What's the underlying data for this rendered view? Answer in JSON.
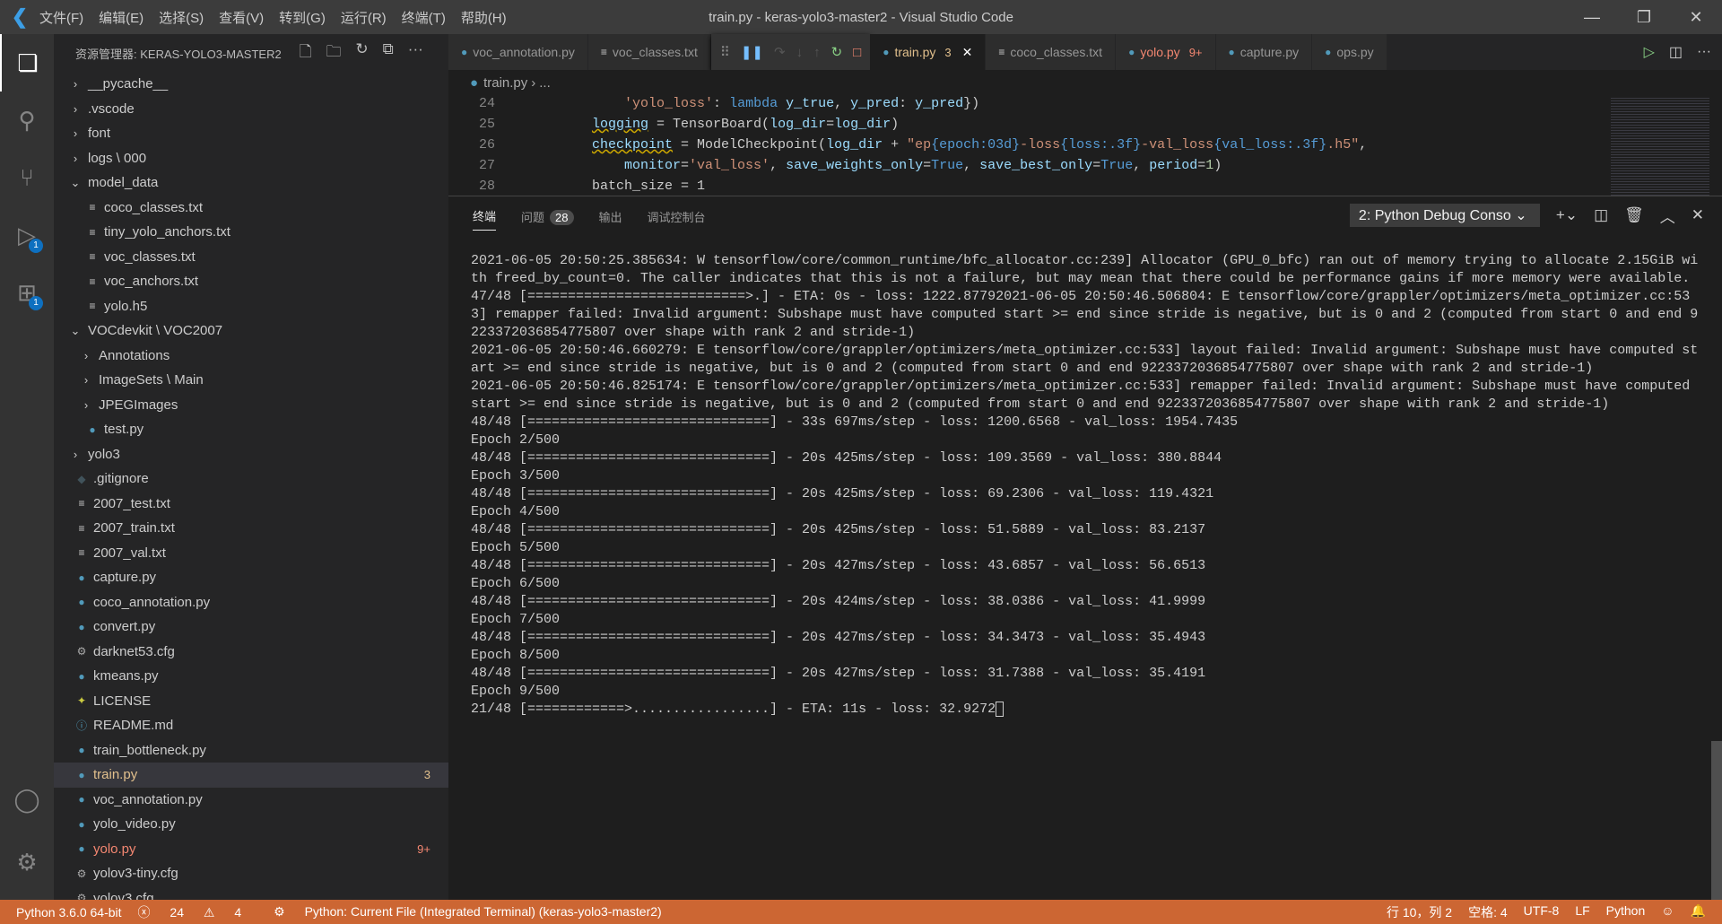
{
  "titlebar": {
    "menu": [
      "文件(F)",
      "编辑(E)",
      "选择(S)",
      "查看(V)",
      "转到(G)",
      "运行(R)",
      "终端(T)",
      "帮助(H)"
    ],
    "title": "train.py - keras-yolo3-master2 - Visual Studio Code"
  },
  "activity": {
    "badges": {
      "debug": "1",
      "extensions": "1"
    }
  },
  "sidebar": {
    "title": "资源管理器: KERAS-YOLO3-MASTER2",
    "items": [
      {
        "label": "__pycache__",
        "type": "folder",
        "indent": 0,
        "open": false
      },
      {
        "label": ".vscode",
        "type": "folder",
        "indent": 0,
        "open": false
      },
      {
        "label": "font",
        "type": "folder",
        "indent": 0,
        "open": false
      },
      {
        "label": "logs \\ 000",
        "type": "folder",
        "indent": 0,
        "open": false
      },
      {
        "label": "model_data",
        "type": "folder",
        "indent": 0,
        "open": true
      },
      {
        "label": "coco_classes.txt",
        "type": "txt",
        "indent": 1
      },
      {
        "label": "tiny_yolo_anchors.txt",
        "type": "txt",
        "indent": 1
      },
      {
        "label": "voc_classes.txt",
        "type": "txt",
        "indent": 1
      },
      {
        "label": "voc_anchors.txt",
        "type": "txt",
        "indent": 1
      },
      {
        "label": "yolo.h5",
        "type": "txt",
        "indent": 1
      },
      {
        "label": "VOCdevkit \\ VOC2007",
        "type": "folder",
        "indent": 0,
        "open": true
      },
      {
        "label": "Annotations",
        "type": "folder",
        "indent": 1,
        "open": false
      },
      {
        "label": "ImageSets \\ Main",
        "type": "folder",
        "indent": 1,
        "open": false
      },
      {
        "label": "JPEGImages",
        "type": "folder",
        "indent": 1,
        "open": false
      },
      {
        "label": "test.py",
        "type": "py",
        "indent": 1
      },
      {
        "label": "yolo3",
        "type": "folder",
        "indent": 0,
        "open": false
      },
      {
        "label": ".gitignore",
        "type": "git",
        "indent": 0
      },
      {
        "label": "2007_test.txt",
        "type": "txt",
        "indent": 0
      },
      {
        "label": "2007_train.txt",
        "type": "txt",
        "indent": 0
      },
      {
        "label": "2007_val.txt",
        "type": "txt",
        "indent": 0
      },
      {
        "label": "capture.py",
        "type": "py",
        "indent": 0
      },
      {
        "label": "coco_annotation.py",
        "type": "py",
        "indent": 0
      },
      {
        "label": "convert.py",
        "type": "py",
        "indent": 0
      },
      {
        "label": "darknet53.cfg",
        "type": "cfg",
        "indent": 0
      },
      {
        "label": "kmeans.py",
        "type": "py",
        "indent": 0
      },
      {
        "label": "LICENSE",
        "type": "license",
        "indent": 0
      },
      {
        "label": "README.md",
        "type": "md",
        "indent": 0
      },
      {
        "label": "train_bottleneck.py",
        "type": "py",
        "indent": 0
      },
      {
        "label": "train.py",
        "type": "py",
        "indent": 0,
        "count": "3",
        "selected": true,
        "color": "#e2c08d"
      },
      {
        "label": "voc_annotation.py",
        "type": "py",
        "indent": 0
      },
      {
        "label": "yolo_video.py",
        "type": "py",
        "indent": 0
      },
      {
        "label": "yolo.py",
        "type": "py",
        "indent": 0,
        "count": "9+",
        "color": "#f48771"
      },
      {
        "label": "yolov3-tiny.cfg",
        "type": "cfg",
        "indent": 0
      },
      {
        "label": "yolov3.cfg",
        "type": "cfg",
        "indent": 0
      }
    ]
  },
  "tabs": [
    {
      "label": "voc_annotation.py",
      "icon": "py"
    },
    {
      "label": "voc_classes.txt",
      "icon": "txt"
    },
    {
      "label": "train.py",
      "icon": "py",
      "count": "3",
      "active": true
    },
    {
      "label": "coco_classes.txt",
      "icon": "txt"
    },
    {
      "label": "yolo.py",
      "icon": "py",
      "count": "9+",
      "color": "#f48771"
    },
    {
      "label": "capture.py",
      "icon": "py"
    },
    {
      "label": "ops.py",
      "icon": "py"
    }
  ],
  "breadcrumb": {
    "file": "train.py",
    "rest": "..."
  },
  "editor": {
    "lines": [
      {
        "n": "24",
        "html": "        <span style=\"color:#ce9178\">'yolo_loss'</span>: <span style=\"color:#569cd6\">lambda</span> <span style=\"color:#9cdcfe\">y_true</span>, <span style=\"color:#9cdcfe\">y_pred</span>: <span style=\"color:#9cdcfe\">y_pred</span>})"
      },
      {
        "n": "25",
        "html": "    <span class=\"squig\" style=\"color:#9cdcfe\">logging</span> = TensorBoard(<span style=\"color:#9cdcfe\">log_dir</span>=<span style=\"color:#9cdcfe\">log_dir</span>)"
      },
      {
        "n": "26",
        "html": "    <span class=\"squig\" style=\"color:#9cdcfe\">checkpoint</span> = ModelCheckpoint(<span style=\"color:#9cdcfe\">log_dir</span> + <span style=\"color:#ce9178\">\"ep</span><span style=\"color:#569cd6\">{epoch:03d}</span><span style=\"color:#ce9178\">-loss</span><span style=\"color:#569cd6\">{loss:.3f}</span><span style=\"color:#ce9178\">-val_loss</span><span style=\"color:#569cd6\">{val_loss:.3f}</span><span style=\"color:#ce9178\">.h5\"</span>,"
      },
      {
        "n": "27",
        "html": "        <span style=\"color:#9cdcfe\">monitor</span>=<span style=\"color:#ce9178\">'val_loss'</span>, <span style=\"color:#9cdcfe\">save_weights_only</span>=<span style=\"color:#569cd6\">True</span>, <span style=\"color:#9cdcfe\">save_best_only</span>=<span style=\"color:#569cd6\">True</span>, <span style=\"color:#9cdcfe\">period</span>=<span style=\"color:#b5cea8\">1</span>)"
      },
      {
        "n": "28",
        "html": "    batch_size = 1"
      }
    ]
  },
  "panel": {
    "tabs": [
      "终端",
      "问题",
      "输出",
      "调试控制台"
    ],
    "problems_count": "28",
    "terminal_select": "2: Python Debug Conso",
    "terminal_lines": [
      "2021-06-05 20:50:25.385634: W tensorflow/core/common_runtime/bfc_allocator.cc:239] Allocator (GPU_0_bfc) ran out of memory trying to allocate 2.15GiB wi",
      "th freed_by_count=0. The caller indicates that this is not a failure, but may mean that there could be performance gains if more memory were available.",
      "47/48 [===========================>.] - ETA: 0s - loss: 1222.87792021-06-05 20:50:46.506804: E tensorflow/core/grappler/optimizers/meta_optimizer.cc:53",
      "3] remapper failed: Invalid argument: Subshape must have computed start >= end since stride is negative, but is 0 and 2 (computed from start 0 and end 9",
      "223372036854775807 over shape with rank 2 and stride-1)",
      "2021-06-05 20:50:46.660279: E tensorflow/core/grappler/optimizers/meta_optimizer.cc:533] layout failed: Invalid argument: Subshape must have computed st",
      "art >= end since stride is negative, but is 0 and 2 (computed from start 0 and end 9223372036854775807 over shape with rank 2 and stride-1)",
      "2021-06-05 20:50:46.825174: E tensorflow/core/grappler/optimizers/meta_optimizer.cc:533] remapper failed: Invalid argument: Subshape must have computed",
      "start >= end since stride is negative, but is 0 and 2 (computed from start 0 and end 9223372036854775807 over shape with rank 2 and stride-1)",
      "48/48 [==============================] - 33s 697ms/step - loss: 1200.6568 - val_loss: 1954.7435",
      "Epoch 2/500",
      "48/48 [==============================] - 20s 425ms/step - loss: 109.3569 - val_loss: 380.8844",
      "Epoch 3/500",
      "48/48 [==============================] - 20s 425ms/step - loss: 69.2306 - val_loss: 119.4321",
      "Epoch 4/500",
      "48/48 [==============================] - 20s 425ms/step - loss: 51.5889 - val_loss: 83.2137",
      "Epoch 5/500",
      "48/48 [==============================] - 20s 427ms/step - loss: 43.6857 - val_loss: 56.6513",
      "Epoch 6/500",
      "48/48 [==============================] - 20s 424ms/step - loss: 38.0386 - val_loss: 41.9999",
      "Epoch 7/500",
      "48/48 [==============================] - 20s 427ms/step - loss: 34.3473 - val_loss: 35.4943",
      "Epoch 8/500",
      "48/48 [==============================] - 20s 427ms/step - loss: 31.7388 - val_loss: 35.4191",
      "Epoch 9/500",
      "21/48 [============>.................] - ETA: 11s - loss: 32.9272"
    ]
  },
  "statusbar": {
    "interpreter": "Python 3.6.0 64-bit",
    "errors": "24",
    "warnings": "4",
    "debug_config": "Python: Current File (Integrated Terminal) (keras-yolo3-master2)",
    "position": "行 10，列 2",
    "spaces": "空格: 4",
    "encoding": "UTF-8",
    "eol": "LF",
    "language": "Python",
    "color": "#cc6633"
  }
}
